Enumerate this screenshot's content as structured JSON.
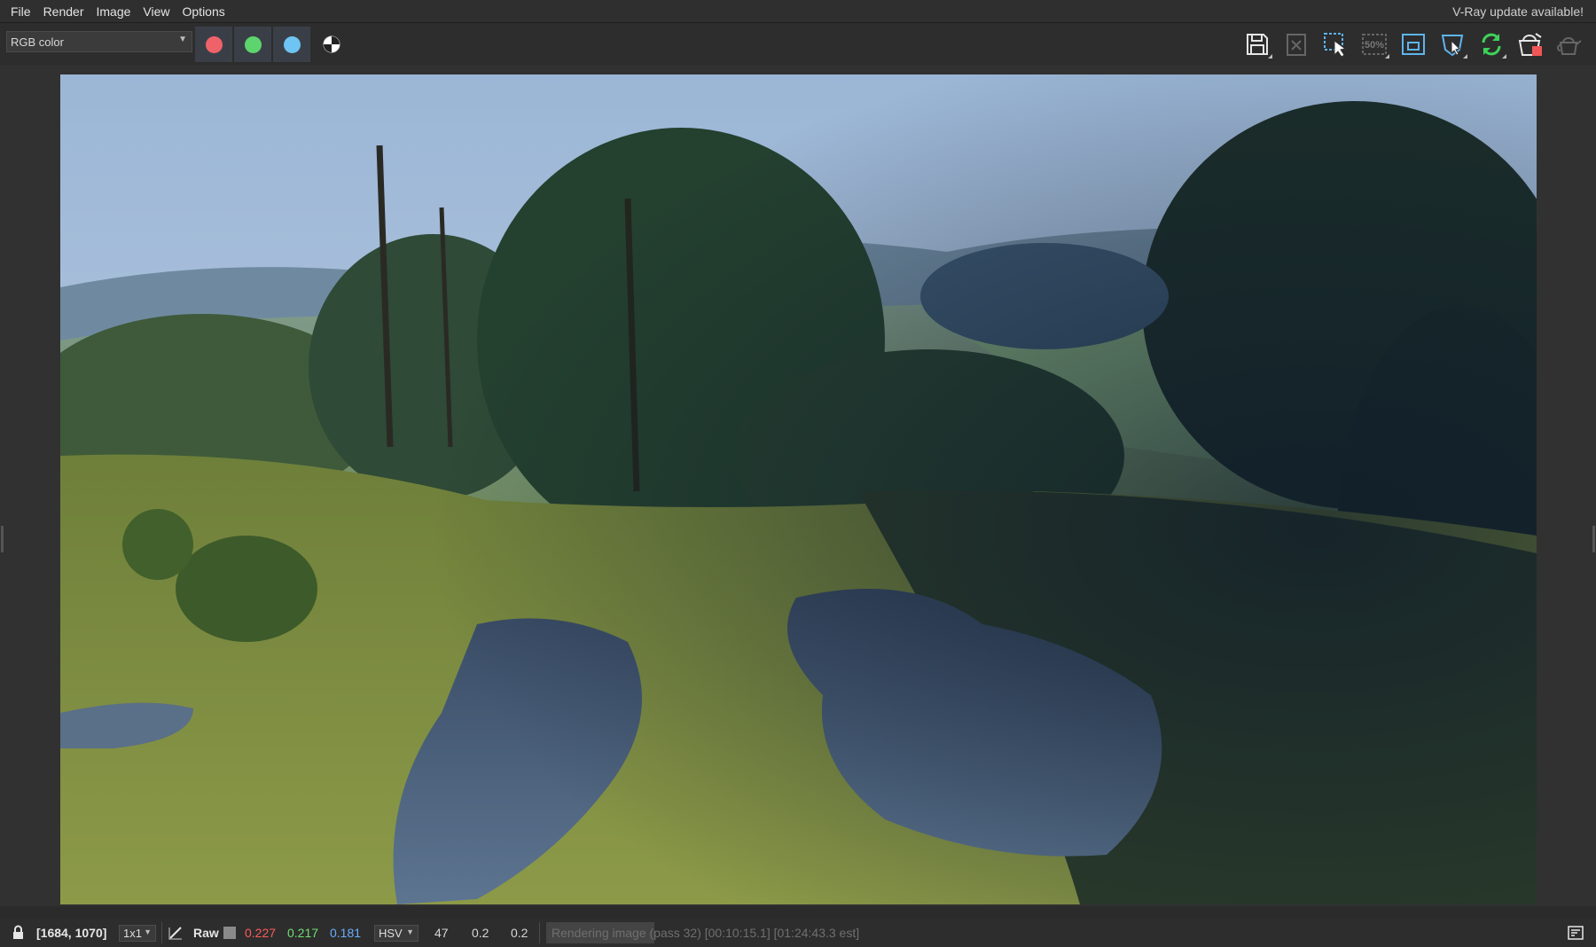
{
  "menu": [
    "File",
    "Render",
    "Image",
    "View",
    "Options"
  ],
  "update_notice": "V-Ray update available!",
  "toolbar": {
    "channel": "RGB color",
    "channel_buttons": [
      {
        "name": "red-channel",
        "color": "#f0626a"
      },
      {
        "name": "green-channel",
        "color": "#5ed46e"
      },
      {
        "name": "blue-channel",
        "color": "#6ec4f2"
      }
    ],
    "zoom_icon_label": "50%",
    "tools": [
      "save-image",
      "clear-image",
      "region-render",
      "zoom-50",
      "fit-window",
      "track-mouse",
      "refresh-render",
      "stop-render",
      "render-last"
    ]
  },
  "statusbar": {
    "coords": "[1684, 1070]",
    "sample_size": "1x1",
    "mode": "Raw",
    "r": "0.227",
    "g": "0.217",
    "b": "0.181",
    "color_space": "HSV",
    "h": "47",
    "s": "0.2",
    "v": "0.2",
    "progress_text": "Rendering image (pass 32) [00:10:15.1] [01:24:43.3 est]",
    "progress_fraction": 0.17
  }
}
